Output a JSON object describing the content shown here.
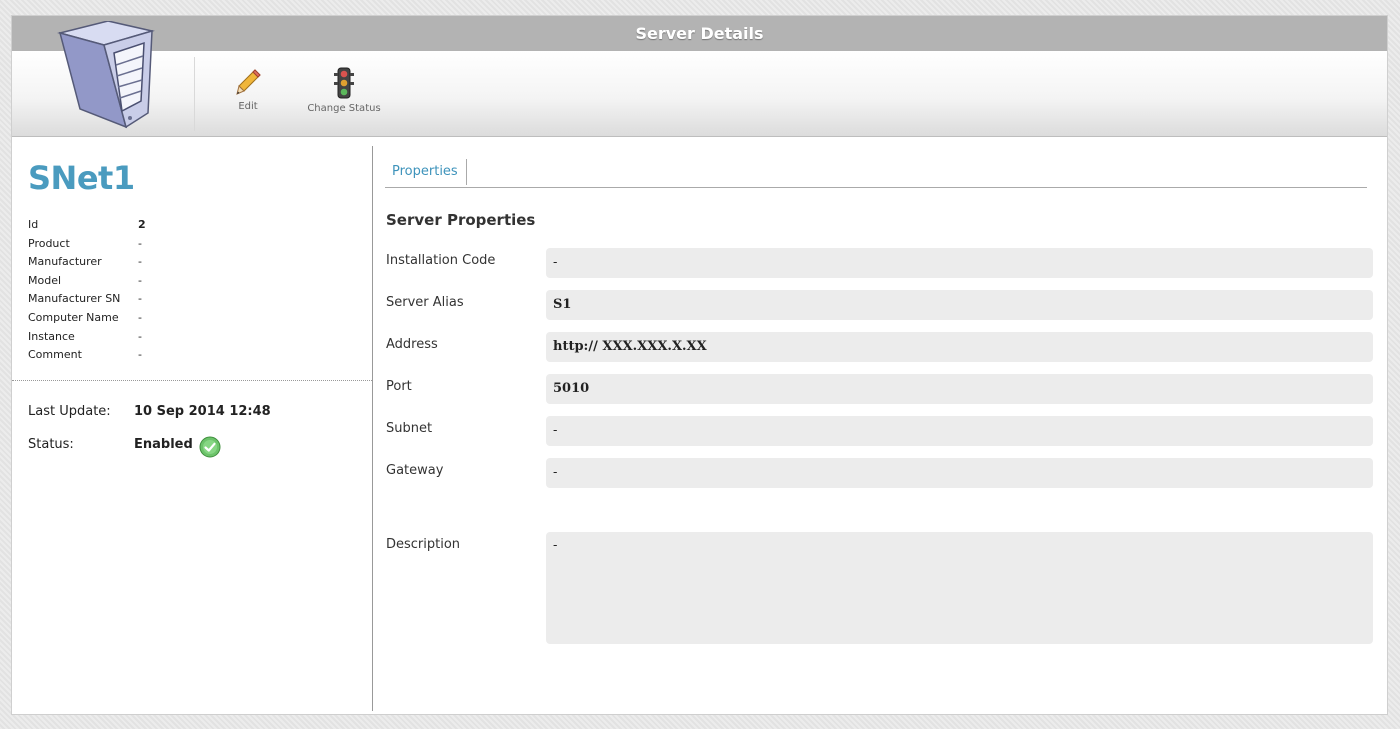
{
  "window": {
    "title": "Server Details"
  },
  "toolbar": {
    "buttons": [
      {
        "label": "Edit",
        "icon": "pencil-icon"
      },
      {
        "label": "Change Status",
        "icon": "traffic-light-icon"
      }
    ]
  },
  "server": {
    "name": "SNet1",
    "info": [
      {
        "key": "Id",
        "value": "2"
      },
      {
        "key": "Product",
        "value": "-"
      },
      {
        "key": "Manufacturer",
        "value": "-"
      },
      {
        "key": "Model",
        "value": "-"
      },
      {
        "key": "Manufacturer SN",
        "value": "-"
      },
      {
        "key": "Computer Name",
        "value": "-"
      },
      {
        "key": "Instance",
        "value": "-"
      },
      {
        "key": "Comment",
        "value": "-"
      }
    ],
    "last_update_label": "Last Update:",
    "last_update_value": "10 Sep 2014 12:48",
    "status_label": "Status:",
    "status_value": "Enabled"
  },
  "tabs": [
    {
      "label": "Properties",
      "active": true
    }
  ],
  "properties": {
    "title": "Server Properties",
    "fields": [
      {
        "label": "Installation Code",
        "value": "-"
      },
      {
        "label": "Server Alias",
        "value": "S1"
      },
      {
        "label": "Address",
        "value": "http:// XXX.XXX.X.XX"
      },
      {
        "label": "Port",
        "value": "5010"
      },
      {
        "label": "Subnet",
        "value": "-"
      },
      {
        "label": "Gateway",
        "value": "-"
      },
      {
        "label": "Description",
        "value": "-"
      }
    ]
  },
  "colors": {
    "accent": "#4a9bbf",
    "titlebar": "#b3b3b3",
    "field_bg": "#ececec",
    "status_ok": "#5cb85c"
  }
}
